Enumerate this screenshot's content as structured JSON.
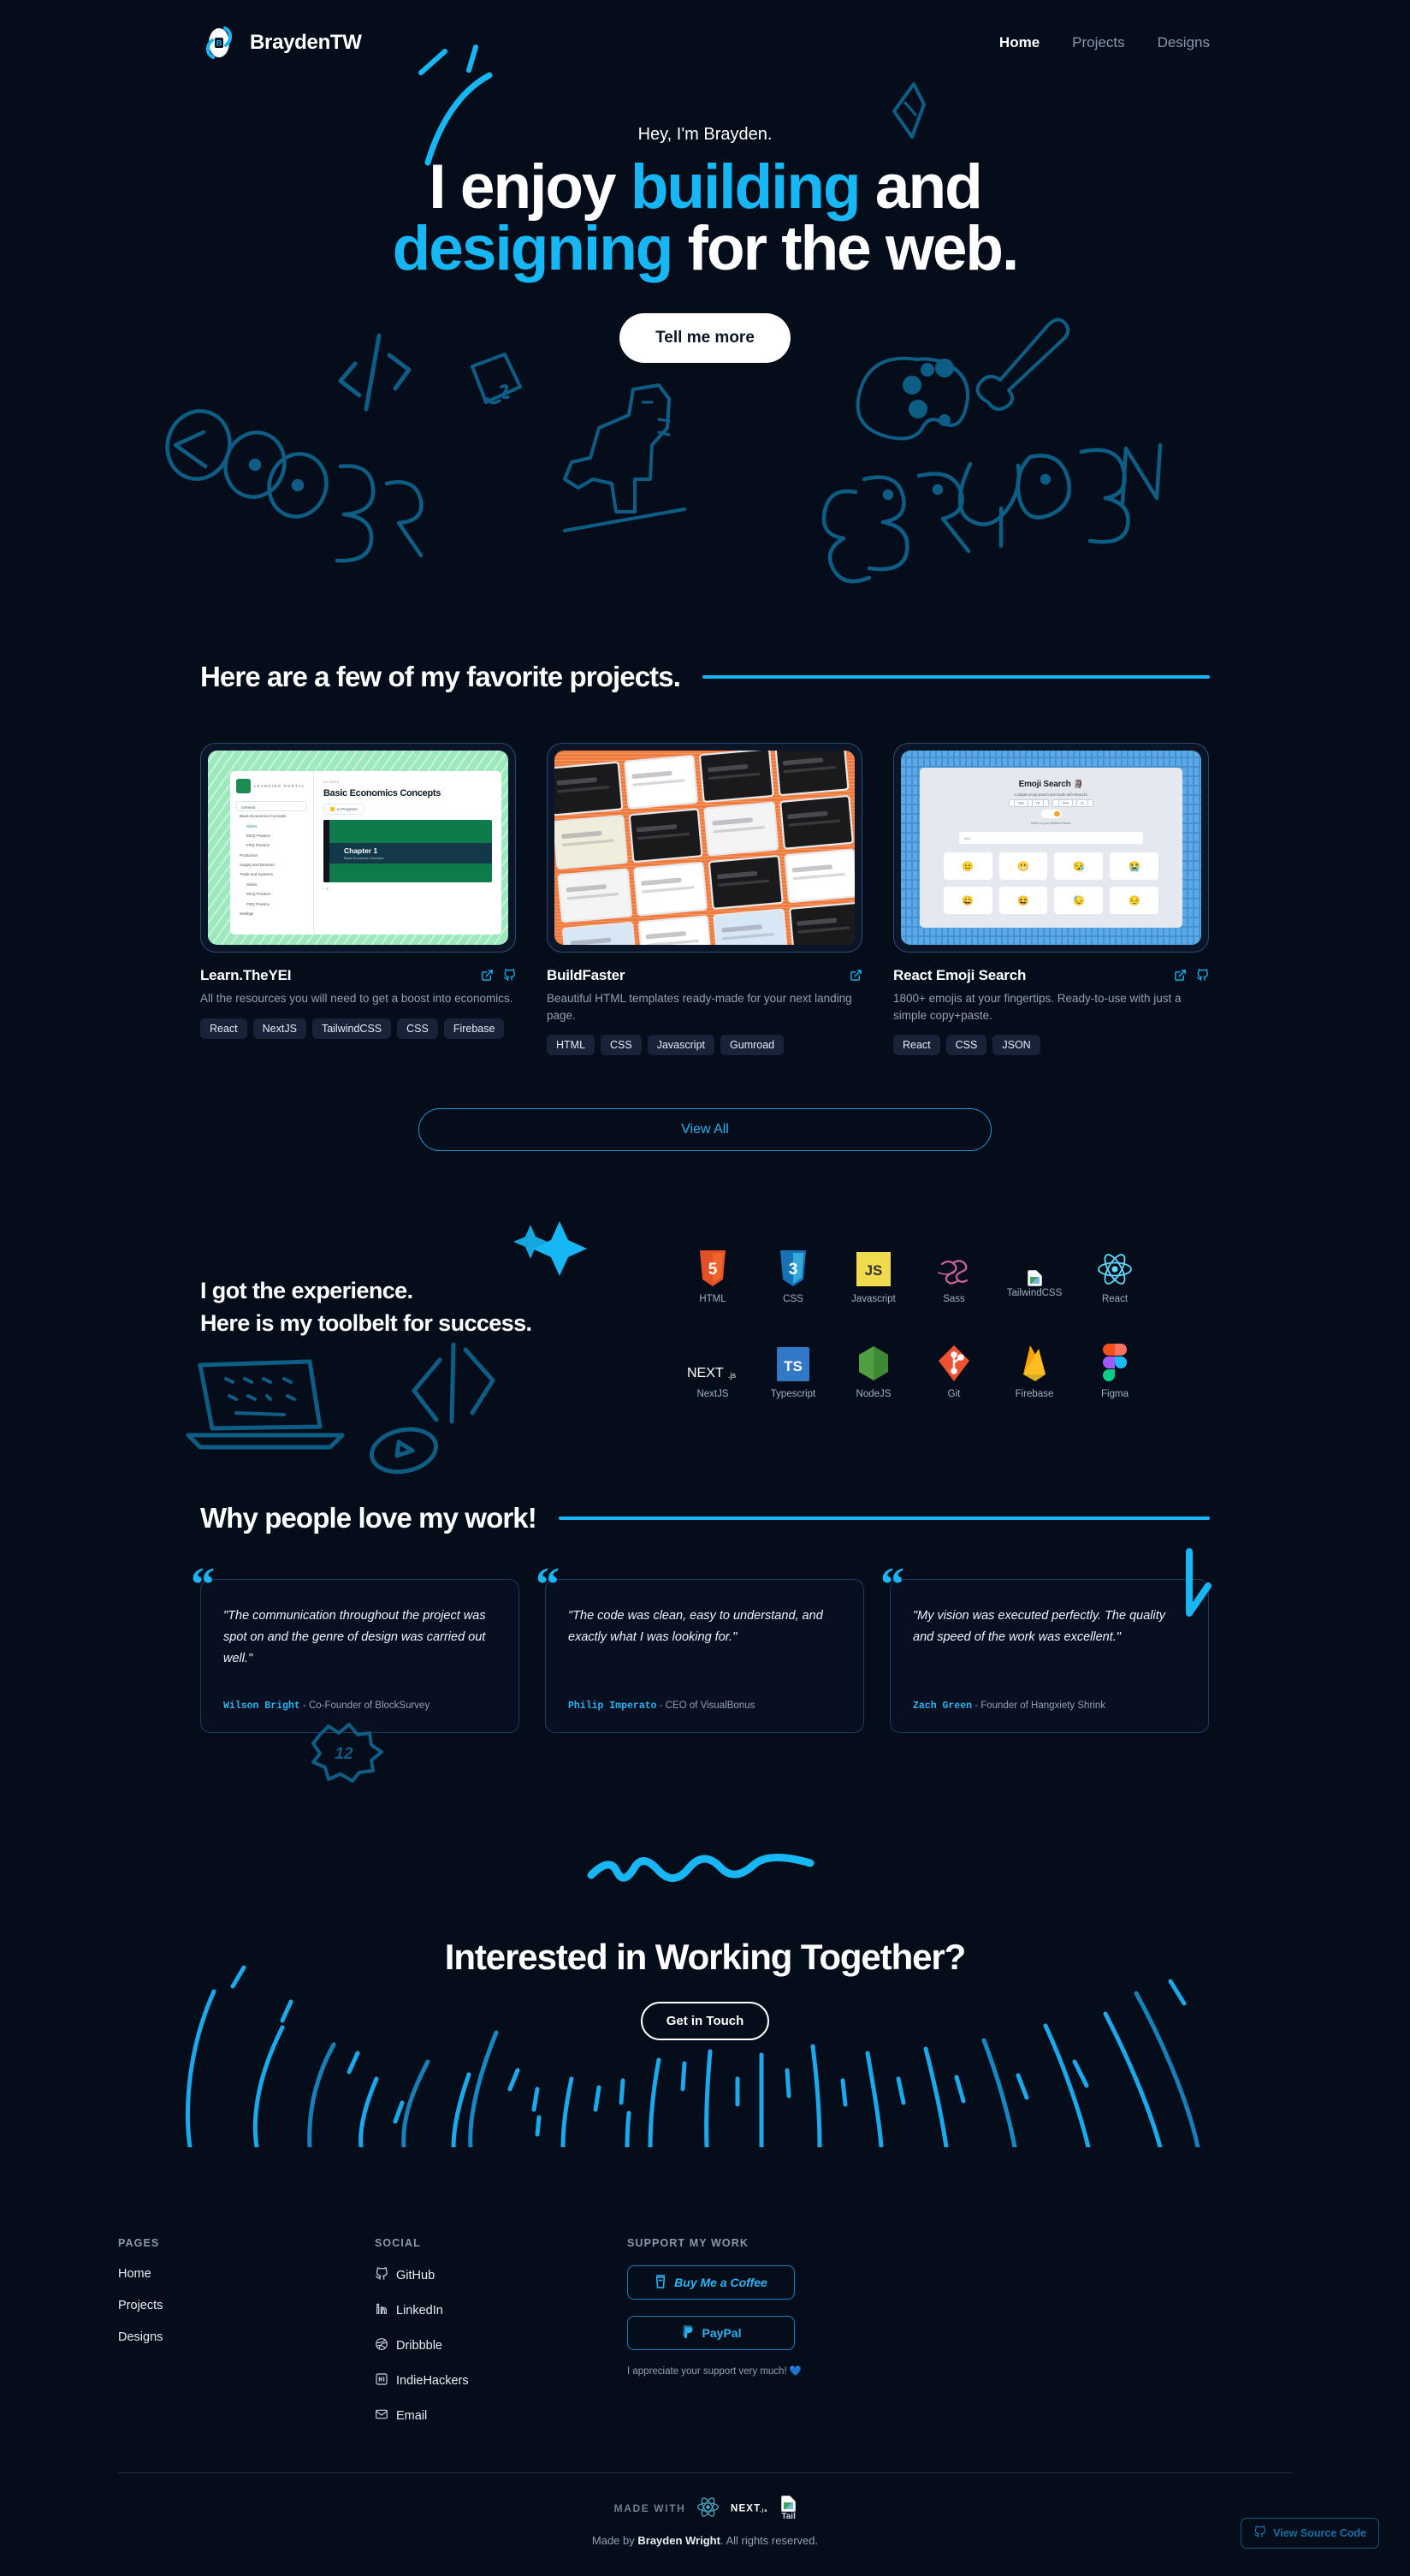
{
  "colors": {
    "bg": "#050d1b",
    "accent": "#17b6f5",
    "muted": "#93a0b3",
    "card": "#18233a"
  },
  "nav": {
    "brand": "BraydenTW",
    "brand_logo_icon": "brayden-logo-icon",
    "links": [
      {
        "label": "Home",
        "active": true
      },
      {
        "label": "Projects",
        "active": false
      },
      {
        "label": "Designs",
        "active": false
      }
    ]
  },
  "hero": {
    "kicker": "Hey, I'm Brayden.",
    "line1_a": "I enjoy ",
    "line1_b": "building",
    "line1_c": " and",
    "line2_a": "designing",
    "line2_b": " for the web.",
    "cta": "Tell me more",
    "doodles": [
      "coder-graffiti",
      "code-brackets",
      "js-box",
      "dino-sketch",
      "palette-sketch",
      "paintbrush-sketch",
      "brayden-graffiti",
      "swoosh-line",
      "pencil-sketch"
    ]
  },
  "projects": {
    "heading": "Here are a few of my favorite projects.",
    "view_all": "View All",
    "items": [
      {
        "title": "Learn.TheYEI",
        "desc": "All the resources you will need to get a boost into economics.",
        "tags": [
          "React",
          "NextJS",
          "TailwindCSS",
          "CSS",
          "Firebase"
        ],
        "has_external": true,
        "has_github": true,
        "preview": {
          "app_name": "LEARNING PORTAL",
          "select": "General",
          "eyebrow": "SLIDES",
          "title": "Basic Economics Concepts",
          "status": "In Progress",
          "slide_title": "Chapter 1",
          "slide_sub": "Basic Economic Concepts",
          "nav": [
            "Basic Economics Concepts",
            "Slides",
            "MCQ Practice",
            "FRQ Practice",
            "Production",
            "Supply and Demand",
            "Trade and Systems",
            "Slides",
            "MCQ Practice",
            "FRQ Practice"
          ],
          "settings": "Settings",
          "pager": "‹   1   ›"
        }
      },
      {
        "title": "BuildFaster",
        "desc": "Beautiful HTML templates ready-made for your next landing page.",
        "tags": [
          "HTML",
          "CSS",
          "Javascript",
          "Gumroad"
        ],
        "has_external": true,
        "has_github": false
      },
      {
        "title": "React Emoji Search",
        "desc": "1800+ emojis at your fingertips. Ready-to-use with just a simple copy+paste.",
        "tags": [
          "React",
          "CSS",
          "JSON"
        ],
        "has_external": true,
        "has_github": true,
        "preview": {
          "title": "Emoji Search 🗿",
          "subtitle": "A simple emoji search tool made with ReactJS.",
          "badge_star": "Star",
          "badge_star_count": "78",
          "badge_fork": "Fork",
          "badge_fork_count": "21",
          "toggle_note": "Switch to your preferred theme.",
          "input_placeholder": "face",
          "emojis": [
            "😐",
            "😬",
            "😪",
            "😭",
            "😀",
            "😆",
            "😓",
            "😔"
          ]
        }
      }
    ]
  },
  "skills": {
    "heading_line1": "I got the experience.",
    "heading_line2": "Here is my toolbelt for success.",
    "row1": [
      {
        "label": "HTML",
        "icon": "html5-icon"
      },
      {
        "label": "CSS",
        "icon": "css3-icon"
      },
      {
        "label": "Javascript",
        "icon": "javascript-icon"
      },
      {
        "label": "Sass",
        "icon": "sass-icon"
      },
      {
        "label": "TailwindCSS",
        "icon": "tailwindcss-icon-broken"
      },
      {
        "label": "React",
        "icon": "react-icon"
      }
    ],
    "row2": [
      {
        "label": "NextJS",
        "icon": "nextjs-icon"
      },
      {
        "label": "Typescript",
        "icon": "typescript-icon"
      },
      {
        "label": "NodeJS",
        "icon": "nodejs-icon"
      },
      {
        "label": "Git",
        "icon": "git-icon"
      },
      {
        "label": "Firebase",
        "icon": "firebase-icon"
      },
      {
        "label": "Figma",
        "icon": "figma-icon"
      }
    ]
  },
  "testimonials": {
    "heading": "Why people love my work!",
    "items": [
      {
        "quote": "\"The communication throughout the project was spot on and the genre of design was carried out well.\"",
        "name": "Wilson Bright",
        "role": " - Co-Founder of BlockSurvey"
      },
      {
        "quote": "\"The code was clean, easy to understand, and exactly what I was looking for.\"",
        "name": "Philip Imperato",
        "role": " - CEO of VisualBonus"
      },
      {
        "quote": "\"My vision was executed perfectly. The quality and speed of the work was excellent.\"",
        "name": "Zach Green",
        "role": " - Founder of Hangxiety Shrink"
      }
    ]
  },
  "cta": {
    "heading": "Interested in Working Together?",
    "button": "Get in Touch"
  },
  "footer": {
    "pages_head": "PAGES",
    "pages": [
      "Home",
      "Projects",
      "Designs"
    ],
    "social_head": "SOCIAL",
    "social": [
      {
        "label": "GitHub",
        "icon": "github-icon"
      },
      {
        "label": "LinkedIn",
        "icon": "linkedin-icon"
      },
      {
        "label": "Dribbble",
        "icon": "dribbble-icon"
      },
      {
        "label": "IndieHackers",
        "icon": "indiehackers-icon"
      },
      {
        "label": "Email",
        "icon": "email-icon"
      }
    ],
    "support_head": "SUPPORT MY WORK",
    "coffee": "Buy Me a Coffee",
    "paypal": "PayPal",
    "support_note": "I appreciate your support very much! 💙",
    "made_with": "MADE WITH",
    "made_with_icons": [
      "react-icon",
      "nextjs-icon",
      "tailwindcss-icon-broken"
    ],
    "tailwind_alt": "Tail",
    "copyright_a": "Made by ",
    "copyright_b": "Brayden Wright",
    "copyright_c": ". All rights reserved.",
    "source_badge": "View Source Code"
  }
}
